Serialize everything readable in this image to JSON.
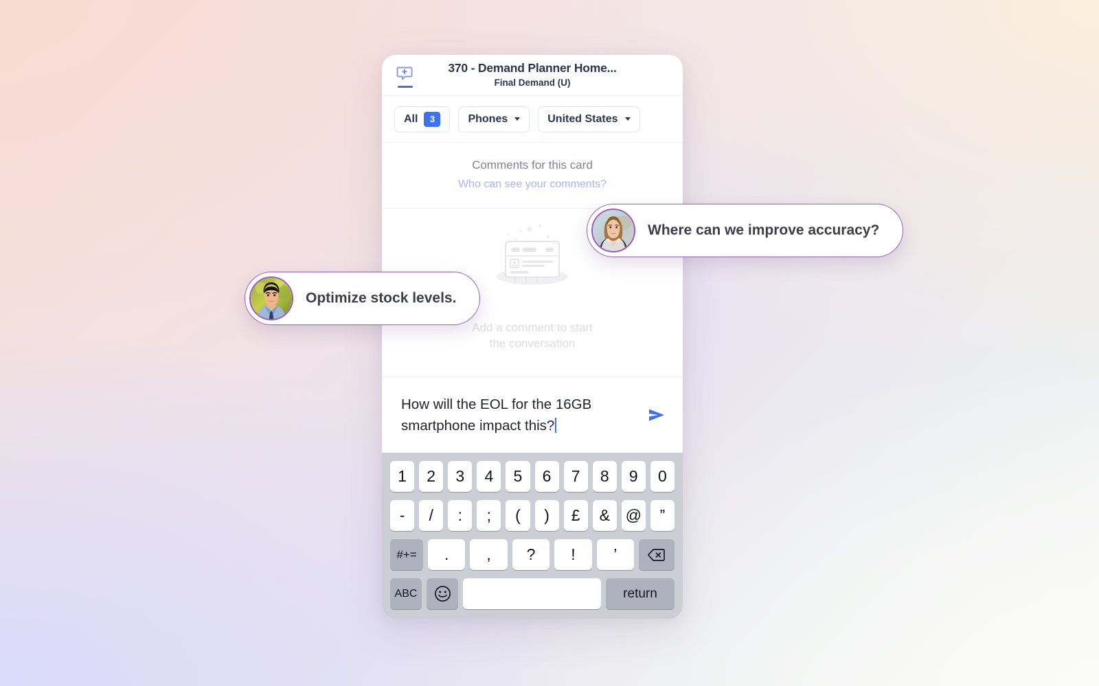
{
  "header": {
    "icon": "add-comment-icon",
    "title": "370 - Demand Planner Home...",
    "subtitle": "Final Demand (U)"
  },
  "filters": {
    "all": {
      "label": "All",
      "count": "3"
    },
    "category": {
      "label": "Phones",
      "icon": "chevron-down-icon"
    },
    "region": {
      "label": "United States",
      "icon": "chevron-down-icon"
    }
  },
  "comments_banner": {
    "title": "Comments for this card",
    "link": "Who can see your comments?"
  },
  "empty_state": {
    "illustration": "empty-card-illustration",
    "line1": "Add a comment to start",
    "line2": "the conversation"
  },
  "composer": {
    "value": "How will the EOL for the 16GB smartphone impact this?",
    "send_icon": "send-arrow-icon"
  },
  "bubbles": [
    {
      "id": "accuracy",
      "text": "Where can we improve accuracy?",
      "avatar": "woman-avatar"
    },
    {
      "id": "stock",
      "text": "Optimize stock levels.",
      "avatar": "man-avatar"
    }
  ],
  "keyboard": {
    "row1": [
      "1",
      "2",
      "3",
      "4",
      "5",
      "6",
      "7",
      "8",
      "9",
      "0"
    ],
    "row2": [
      "-",
      "/",
      ":",
      ";",
      "(",
      ")",
      "£",
      "&",
      "@",
      "”"
    ],
    "row3": {
      "fn": "#+=",
      "keys": [
        ".",
        ",",
        "?",
        "!",
        "’"
      ],
      "backspace": "backspace-icon"
    },
    "row4": {
      "abc": "ABC",
      "emoji": "emoji-icon",
      "space": "",
      "return": "return"
    }
  },
  "colors": {
    "accent_blue": "#4071ef",
    "bubble_border": "#9b59b6",
    "keyboard_bg": "#ccced6",
    "title": "#2b3550"
  }
}
